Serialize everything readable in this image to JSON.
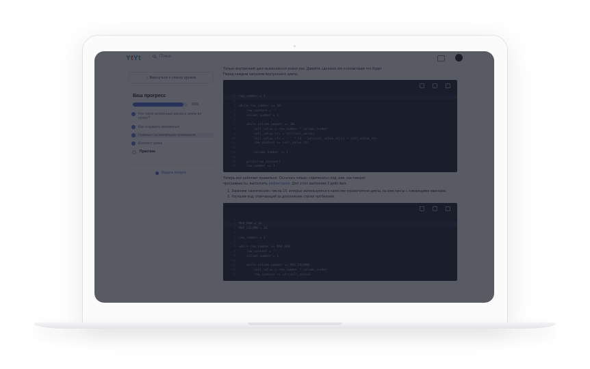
{
  "app": {
    "logo": [
      "Y",
      "t",
      "Y",
      "t"
    ],
    "search_placeholder": "Поиск"
  },
  "sidebar": {
    "back_label": "Вернуться к списку уроков",
    "progress_title": "Ваш прогресс",
    "progress_fraction": 0.93,
    "progress_pct": "93%",
    "steps": [
      {
        "label": "Что такое вложенные циклы и зачем их нужно?",
        "done": true
      },
      {
        "label": "Как создавать вложенные",
        "done": true
      },
      {
        "label": "Главные составляющие вложенного",
        "done": true,
        "active": true
      },
      {
        "label": "Контекст урока",
        "done": true
      },
      {
        "label": "Практика",
        "done": false
      }
    ],
    "ask_label": "Задать вопрос"
  },
  "content": {
    "intro_line1": "Только внутренний цикл выполняется ровно раз. Давайте сделаем это и посмотрим что будет",
    "intro_line2": "Перед каждым запуском внутреннего цикла.",
    "code1": [
      "row_number = 1",
      "",
      "while row_number <= 10:",
      "    row_content = ''",
      "    column_number = 1",
      "",
      "    while column_number <= 10:",
      "        cell_value = row_number * column_number",
      "        cell_value_str = str(cell_value)",
      "        cell_value_str = ' ' * (4 - len(cell_value_str)) + cell_value_str",
      "        row_content += cell_value_str",
      "",
      "        column_number += 1",
      "",
      "    print(row_content)",
      "    row_number += 1"
    ],
    "para2_a": "Теперь все работает правильно. Осталось только «причесать» код, или, как говорят",
    "para2_b": "программисты, выполнить",
    "para2_link": "рефакторинг",
    "para2_c": ". Для этого выполним 2 действия:",
    "list": [
      "Заменим «магические» числа 10, которые используются в качестве ограничителя цикла, на константы с говорящими именами;",
      "Улучшим код, отвечающий за дополнение строки пробелами."
    ],
    "code2": [
      "",
      "MAX_ROW = 10",
      "MAX_COLUMN = 10",
      "",
      "row_number = 1",
      "",
      "while row_number <= MAX_ROW:",
      "    row_content = ''",
      "    column_number = 1",
      "",
      "    while column_number <= MAX_COLUMN:",
      "        cell_value = row_number * column_number",
      "        row_content += str(cell_value)"
    ]
  },
  "colors": {
    "accent": "#4d6fd8",
    "overlay": "#181b28",
    "code_bg": "#22252f"
  }
}
